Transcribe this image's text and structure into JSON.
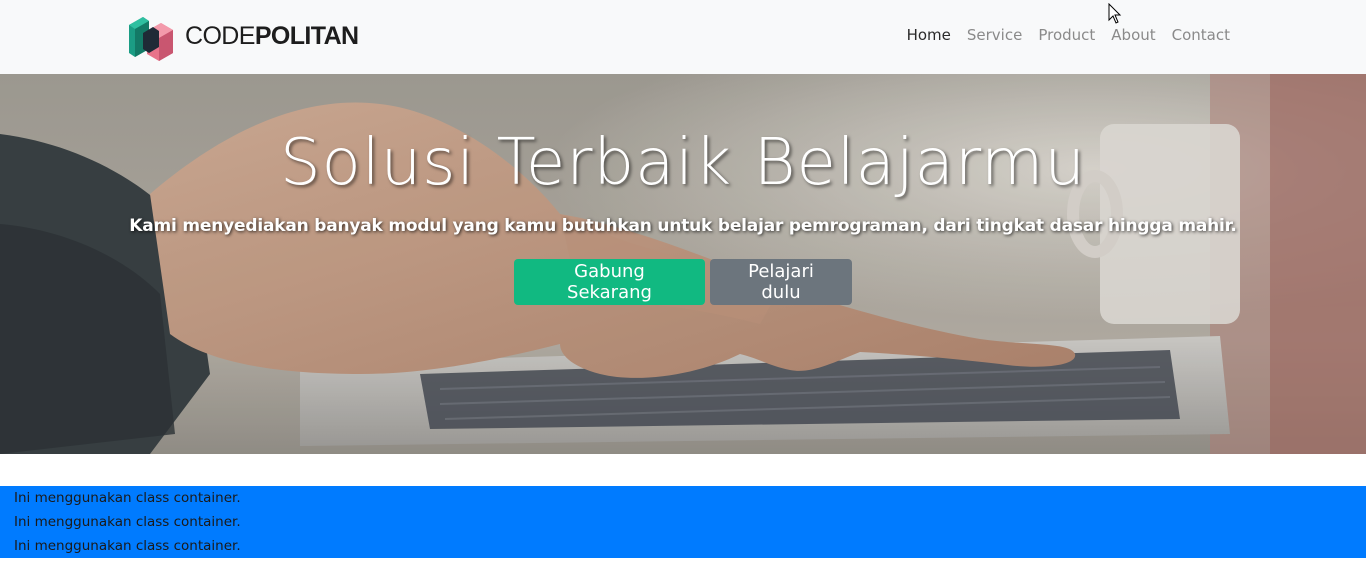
{
  "navbar": {
    "brand": {
      "light": "CODE",
      "bold": "POLITAN"
    },
    "links": [
      "Home",
      "Service",
      "Product",
      "About",
      "Contact"
    ],
    "active_index": 0
  },
  "hero": {
    "title": "Solusi Terbaik Belajarmu",
    "subtitle": "Kami menyediakan banyak modul yang kamu butuhkan untuk belajar pemrograman, dari tingkat dasar hingga mahir.",
    "primary_button": "Gabung Sekarang",
    "secondary_button": "Pelajari dulu"
  },
  "container": {
    "lines": [
      "Ini menggunakan class container.",
      "Ini menggunakan class container.",
      "Ini menggunakan class container."
    ]
  },
  "colors": {
    "navbar_bg": "#f8f9fa",
    "btn_success": "#11b981",
    "btn_secondary": "#6c757d",
    "container_bg": "#007bff"
  },
  "icons": {
    "logo": "codepolitan-cube-logo",
    "cursor": "mouse-pointer-icon"
  }
}
